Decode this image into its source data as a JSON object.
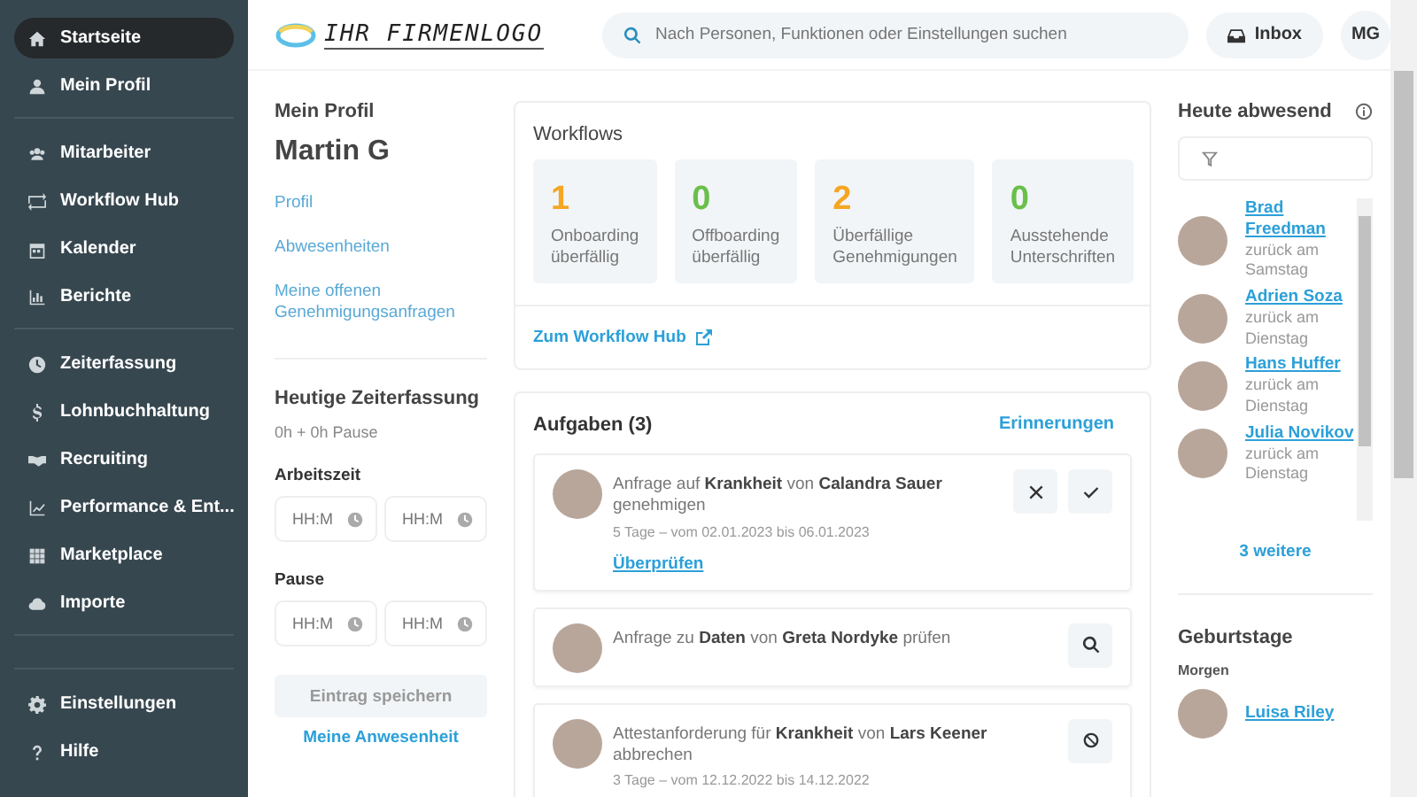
{
  "sidebar": {
    "groups": [
      [
        {
          "label": "Startseite",
          "kind": "home",
          "selected": true
        },
        {
          "label": "Mein Profil",
          "kind": "person",
          "selected": false
        }
      ],
      [
        {
          "label": "Mitarbeiter",
          "kind": "people",
          "selected": false
        },
        {
          "label": "Workflow Hub",
          "kind": "loop",
          "selected": false
        },
        {
          "label": "Kalender",
          "kind": "calendar",
          "selected": false
        },
        {
          "label": "Berichte",
          "kind": "chart",
          "selected": false
        }
      ],
      [
        {
          "label": "Zeiterfassung",
          "kind": "clock",
          "selected": false
        },
        {
          "label": "Lohnbuchhaltung",
          "kind": "dollar",
          "selected": false
        },
        {
          "label": "Recruiting",
          "kind": "handshake",
          "selected": false
        },
        {
          "label": "Performance & Ent...",
          "kind": "trend",
          "selected": false
        },
        {
          "label": "Marketplace",
          "kind": "grid",
          "selected": false
        },
        {
          "label": "Importe",
          "kind": "cloud",
          "selected": false
        }
      ]
    ],
    "bottom": [
      {
        "label": "Einstellungen",
        "kind": "gear",
        "selected": false
      },
      {
        "label": "Hilfe",
        "kind": "help",
        "selected": false
      }
    ]
  },
  "header": {
    "logo": "IHR FIRMENLOGO",
    "search": {
      "placeholder": "Nach Personen, Funktionen oder Einstellungen suchen"
    },
    "inbox": "Inbox",
    "avatar": "MG"
  },
  "profile": {
    "heading": "Mein Profil",
    "name": "Martin G",
    "links": [
      "Profil",
      "Abwesenheiten",
      "Meine offenen Genehmigungsanfragen"
    ]
  },
  "time_tracking": {
    "heading": "Heutige Zeiterfassung",
    "summary": "0h + 0h Pause",
    "sections": [
      {
        "label": "Arbeitszeit",
        "fields": [
          {
            "placeholder": "HH:M"
          },
          {
            "placeholder": "HH:M"
          }
        ]
      },
      {
        "label": "Pause",
        "fields": [
          {
            "placeholder": "HH:M"
          },
          {
            "placeholder": "HH:M"
          }
        ]
      }
    ],
    "save_button": {
      "label": "Eintrag speichern",
      "disabled": true
    },
    "attendance_link": "Meine Anwesenheit"
  },
  "workflows": {
    "title": "Workflows",
    "stats": [
      {
        "value": "1",
        "label": "Onboarding überfällig",
        "color": "#f5a623"
      },
      {
        "value": "0",
        "label": "Offboarding überfällig",
        "color": "#6abf4b"
      },
      {
        "value": "2",
        "label": "Überfällige Genehmigungen",
        "color": "#f5a623"
      },
      {
        "value": "0",
        "label": "Ausstehende Unterschriften",
        "color": "#6abf4b"
      }
    ],
    "link": "Zum Workflow Hub"
  },
  "tasks": {
    "title": "Aufgaben (3)",
    "reminders": "Erinnerungen",
    "items": [
      {
        "text": "Anfrage auf **Krankheit** von **Calandra Sauer** genehmigen",
        "detail": "5 Tage – vom 02.01.2023 bis 06.01.2023",
        "link": "Überprüfen",
        "actions": [
          {
            "kind": "reject"
          },
          {
            "kind": "approve"
          }
        ]
      },
      {
        "text": "Anfrage zu **Daten** von **Greta Nordyke** prüfen",
        "actions": [
          {
            "kind": "search"
          }
        ]
      },
      {
        "text": "Attestanforderung für **Krankheit** von **Lars Keener** abbrechen",
        "detail": "3 Tage – vom 12.12.2022 bis 14.12.2022",
        "actions": [
          {
            "kind": "cancel"
          }
        ]
      }
    ]
  },
  "absent": {
    "title": "Heute abwesend",
    "people": [
      {
        "name": "Brad Freedman",
        "note": "zurück am Samstag"
      },
      {
        "name": "Adrien Soza",
        "note": "zurück am Dienstag"
      },
      {
        "name": "Hans Huffer",
        "note": "zurück am Dienstag"
      },
      {
        "name": "Julia Novikov",
        "note": "zurück am Dienstag"
      }
    ],
    "more": "3 weitere"
  },
  "birthdays": {
    "title": "Geburtstage",
    "groups": [
      {
        "label": "Morgen",
        "people": [
          "Luisa Riley"
        ]
      }
    ]
  }
}
